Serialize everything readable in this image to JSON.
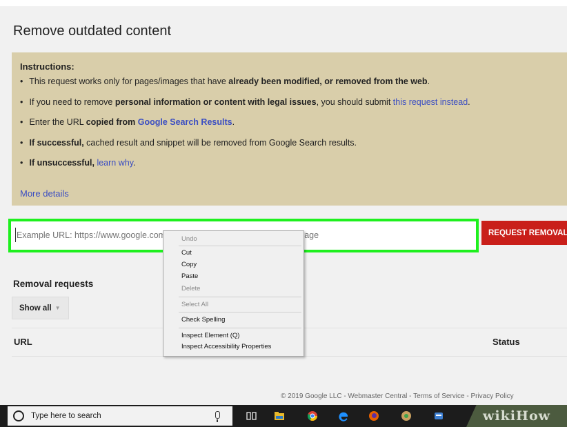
{
  "page": {
    "title": "Remove outdated content"
  },
  "instructions": {
    "title": "Instructions:",
    "item1": {
      "pre": "This request works only for pages/images that have ",
      "bold": "already been modified, or removed from the web",
      "post": "."
    },
    "item2": {
      "pre": "If you need to remove ",
      "bold": "personal information or content with legal issues",
      "mid": ", you should submit ",
      "link": "this request instead",
      "post": "."
    },
    "item3": {
      "pre": "Enter the URL ",
      "bold": "copied from ",
      "link": "Google Search Results",
      "post": "."
    },
    "item4": {
      "bold": "If successful,",
      "post": " cached result and snippet will be removed from Google Search results."
    },
    "item5": {
      "bold": "If unsuccessful,",
      "link": "learn why",
      "post": "."
    },
    "more_details": "More details"
  },
  "url_form": {
    "placeholder": "Example URL: https://www.google.com/url?q=http://www.example.com/oldpage",
    "request_button": "REQUEST REMOVAL"
  },
  "context_menu": {
    "items": [
      "Undo",
      "Cut",
      "Copy",
      "Paste",
      "Delete",
      "Select All",
      "Check Spelling",
      "Inspect Element (Q)",
      "Inspect Accessibility Properties"
    ]
  },
  "removal": {
    "title": "Removal requests",
    "filter": "Show all",
    "columns": {
      "url": "URL",
      "status": "Status"
    }
  },
  "footer": {
    "text": "© 2019 Google LLC - Webmaster Central - Terms of Service - Privacy Policy"
  },
  "taskbar": {
    "search_text": "Type here to search",
    "icons": [
      "microphone-icon",
      "task-view-icon",
      "file-explorer-icon",
      "chrome-icon",
      "edge-icon",
      "firefox-icon",
      "app-icon",
      "app-icon-2"
    ]
  },
  "watermark": "wikiHow",
  "colors": {
    "highlight": "#1ef01e",
    "instructions_bg": "#d9ceaa",
    "link": "#3b4ec2",
    "request_button": "#c91f1a"
  }
}
